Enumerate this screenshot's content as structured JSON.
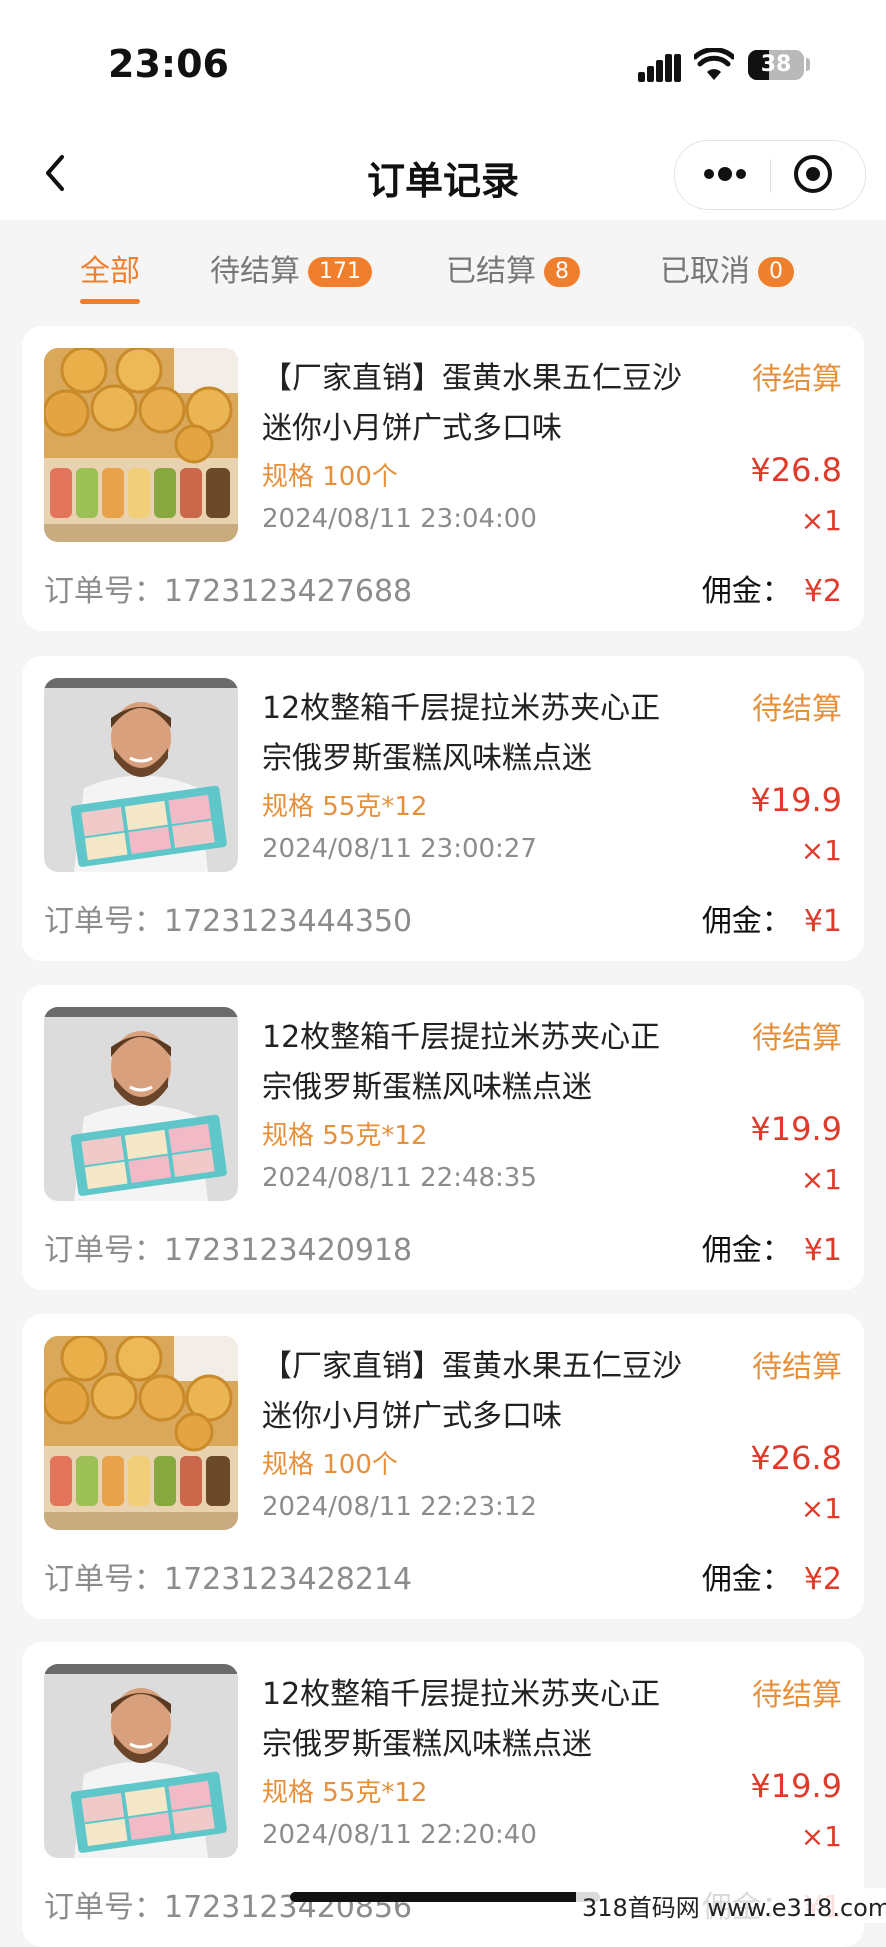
{
  "status_bar": {
    "time": "23:06",
    "battery": "38",
    "battery_level": 0.38
  },
  "header": {
    "title": "订单记录"
  },
  "tabs": [
    {
      "label": "全部",
      "active": true
    },
    {
      "label": "待结算",
      "count": "171"
    },
    {
      "label": "已结算",
      "count": "8"
    },
    {
      "label": "已取消",
      "count": "0"
    }
  ],
  "labels": {
    "order_prefix": "订单号：",
    "commission_prefix": "佣金："
  },
  "orders": [
    {
      "image": "mooncake-image",
      "title": "【厂家直销】蛋黄水果五仁豆沙迷你小月饼广式多口味",
      "spec": "规格 100个",
      "date": "2024/08/11 23:04:00",
      "status": "待结算",
      "price": "¥26.8",
      "qty": "×1",
      "order_no": "1723123427688",
      "commission": "¥2"
    },
    {
      "image": "baker-cake-box-image",
      "title": "12枚整箱千层提拉米苏夹心正宗俄罗斯蛋糕风味糕点迷",
      "spec": "规格 55克*12",
      "date": "2024/08/11 23:00:27",
      "status": "待结算",
      "price": "¥19.9",
      "qty": "×1",
      "order_no": "1723123444350",
      "commission": "¥1"
    },
    {
      "image": "baker-cake-box-image",
      "title": "12枚整箱千层提拉米苏夹心正宗俄罗斯蛋糕风味糕点迷",
      "spec": "规格 55克*12",
      "date": "2024/08/11 22:48:35",
      "status": "待结算",
      "price": "¥19.9",
      "qty": "×1",
      "order_no": "1723123420918",
      "commission": "¥1"
    },
    {
      "image": "mooncake-image",
      "title": "【厂家直销】蛋黄水果五仁豆沙迷你小月饼广式多口味",
      "spec": "规格 100个",
      "date": "2024/08/11 22:23:12",
      "status": "待结算",
      "price": "¥26.8",
      "qty": "×1",
      "order_no": "1723123428214",
      "commission": "¥2"
    },
    {
      "image": "baker-cake-box-image",
      "title": "12枚整箱千层提拉米苏夹心正宗俄罗斯蛋糕风味糕点迷",
      "spec": "规格 55克*12",
      "date": "2024/08/11 22:20:40",
      "status": "待结算",
      "price": "¥19.9",
      "qty": "×1",
      "order_no": "1723123420856",
      "commission": "¥1"
    }
  ],
  "watermark": "318首码网 www.e318.com",
  "colors": {
    "accent": "#ef7f2c",
    "price": "#e03a2a",
    "spec": "#e6903c"
  }
}
